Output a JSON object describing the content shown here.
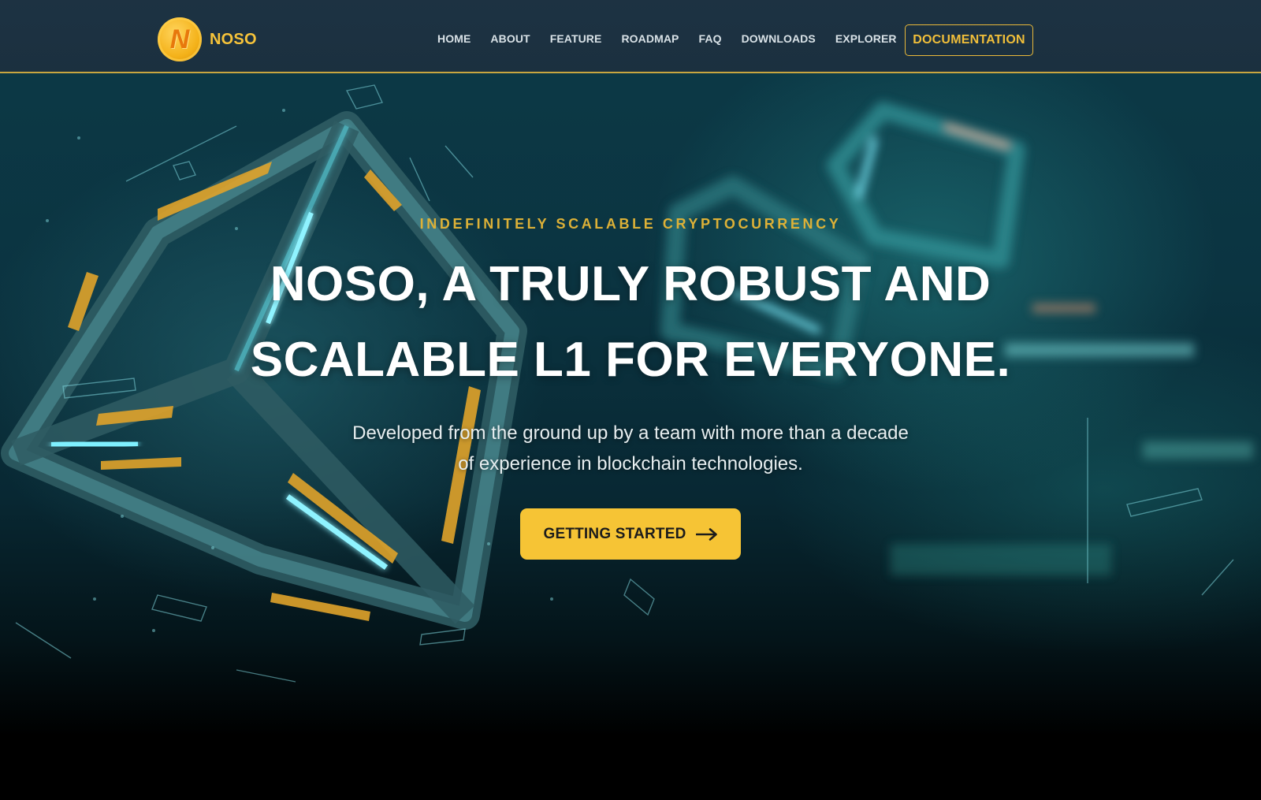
{
  "brand": {
    "logo_letter": "N",
    "name": "NOSO",
    "accent_color": "#f6c435",
    "logo_icon": "noso-coin-logo"
  },
  "nav": {
    "items": [
      {
        "label": "HOME"
      },
      {
        "label": "ABOUT"
      },
      {
        "label": "FEATURE"
      },
      {
        "label": "ROADMAP"
      },
      {
        "label": "FAQ"
      },
      {
        "label": "DOWNLOADS"
      },
      {
        "label": "EXPLORER"
      }
    ],
    "documentation_label": "DOCUMENTATION"
  },
  "hero": {
    "kicker": "INDEFINITELY SCALABLE CRYPTOCURRENCY",
    "headline_line1": "NOSO, A TRULY ROBUST AND",
    "headline_line2": "SCALABLE L1 FOR EVERYONE.",
    "subtext_line1": "Developed from the ground up by a team with more than a decade",
    "subtext_line2": "of experience in blockchain technologies.",
    "cta_label": "GETTING STARTED",
    "cta_icon": "arrow-right-icon"
  }
}
